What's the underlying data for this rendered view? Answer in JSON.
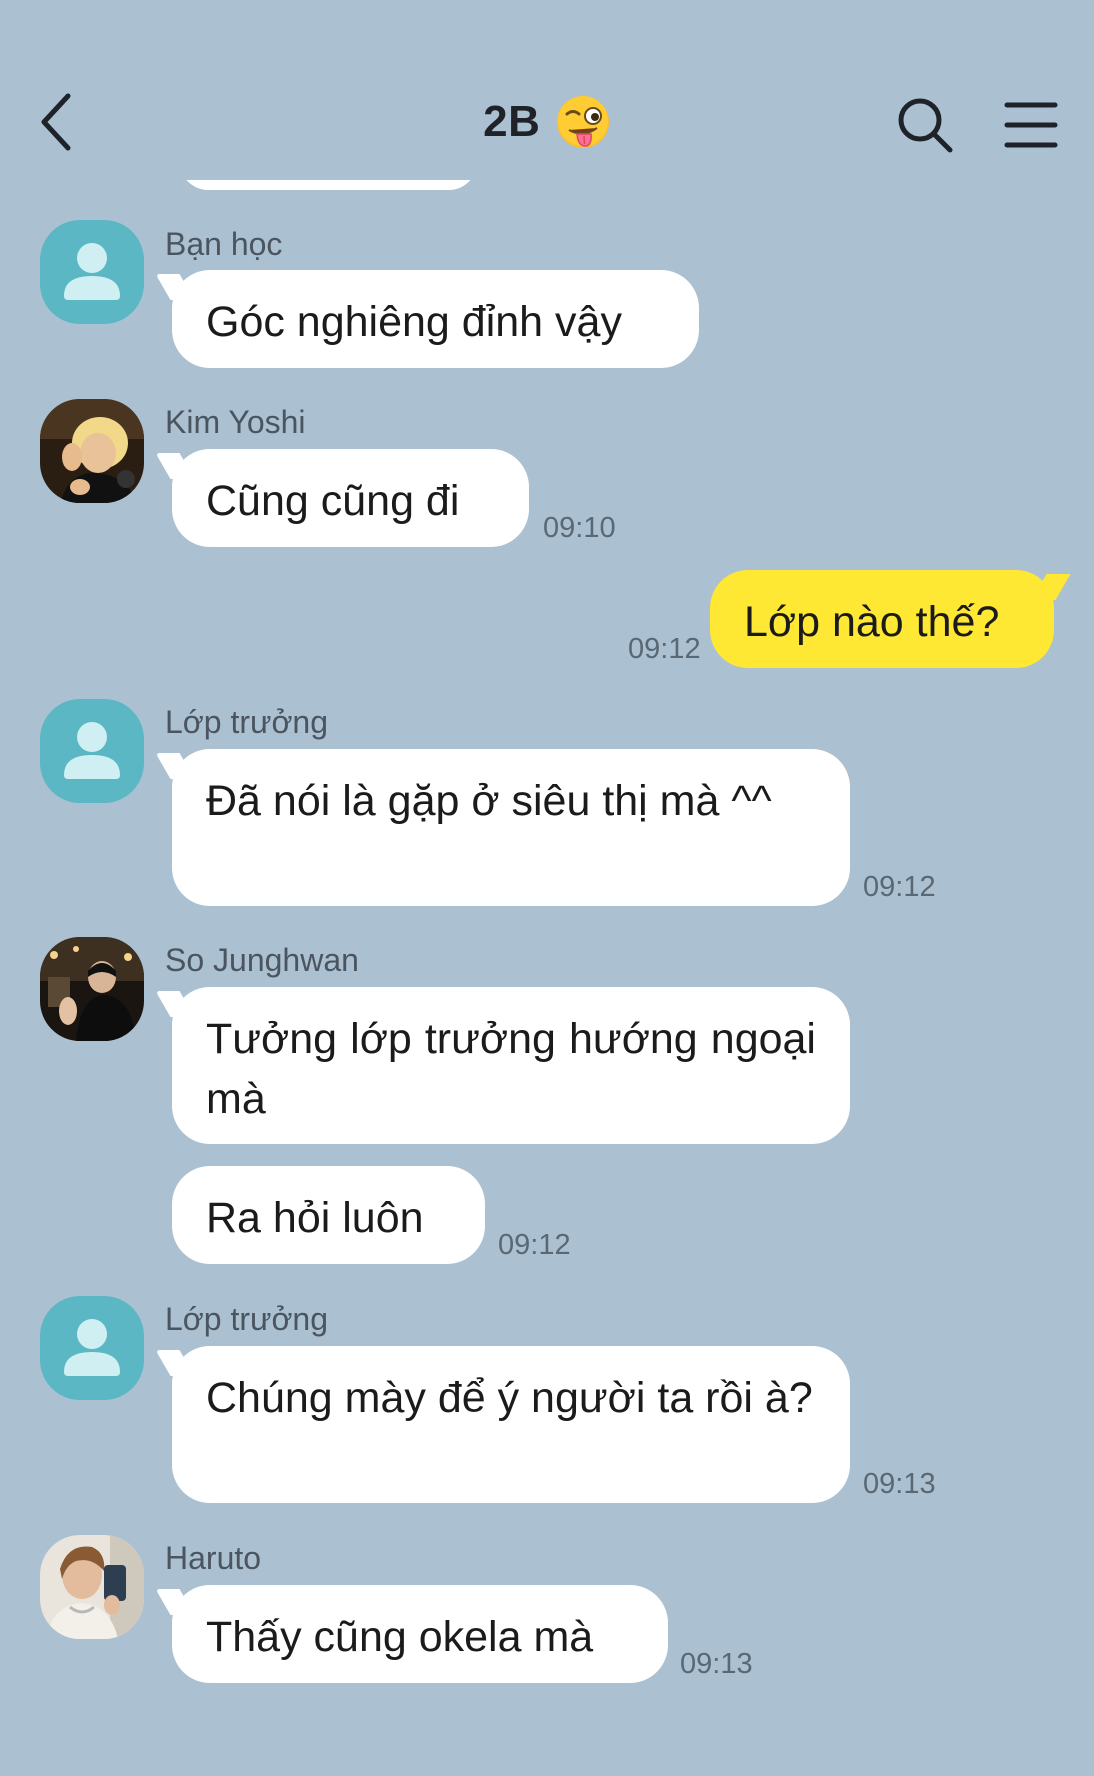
{
  "header": {
    "title": "2B",
    "back_icon": "chevron-left-icon",
    "title_emoji": "winking-face-with-tongue-emoji",
    "search_icon": "search-icon",
    "menu_icon": "hamburger-menu-icon"
  },
  "colors": {
    "background": "#abc1d1",
    "incoming_bubble": "#ffffff",
    "outgoing_bubble": "#fee834",
    "default_avatar": "#5cb7c4",
    "timestamp": "#5a6874"
  },
  "messages": [
    {
      "sender": "Bạn học",
      "text": "Góc nghiêng đỉnh vậy",
      "time": ""
    },
    {
      "sender": "Kim Yoshi",
      "text": "Cũng cũng đi",
      "time": "09:10"
    },
    {
      "sender": "",
      "text": "Lớp nào thế?",
      "time": "09:12",
      "mine": true
    },
    {
      "sender": "Lớp trưởng",
      "text": "Đã nói là gặp ở siêu thị mà ^^",
      "time": "09:12"
    },
    {
      "sender": "So Junghwan",
      "text": "Tưởng lớp trưởng hướng ngoại mà",
      "time": ""
    },
    {
      "sender": "",
      "text": "Ra hỏi luôn",
      "time": "09:12"
    },
    {
      "sender": "Lớp trưởng",
      "text": "Chúng mày để ý người ta rồi à?",
      "time": "09:13"
    },
    {
      "sender": "Haruto",
      "text": "Thấy cũng okela mà",
      "time": "09:13"
    }
  ]
}
